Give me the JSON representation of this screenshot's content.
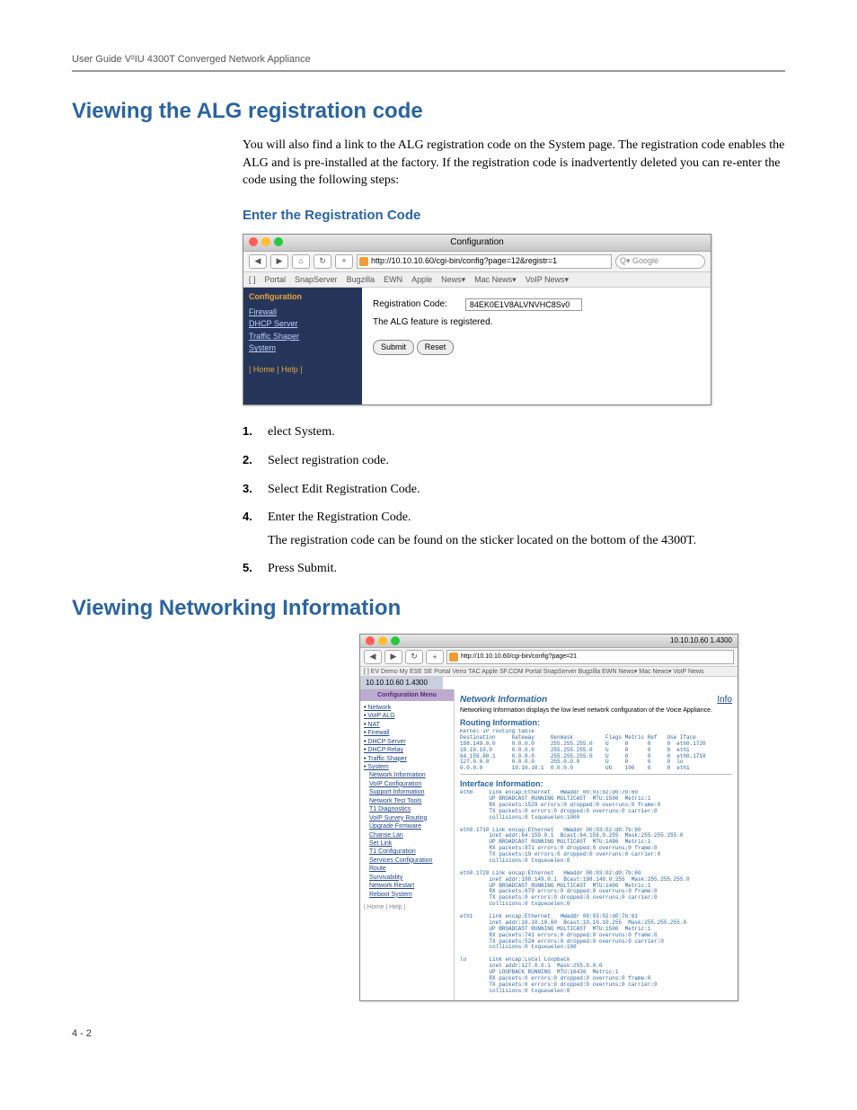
{
  "header": "User Guide V²IU 4300T Converged Network Appliance",
  "section1": {
    "title": "Viewing the ALG registration code",
    "intro": "You will also find a link to the ALG registration code on the System page.  The registration code enables the ALG and is pre-installed at the factory.  If the registration code is inadvertently deleted you can re-enter the code using the following steps:",
    "subhead": "Enter the Registration Code",
    "steps": [
      "elect System.",
      "Select registration code.",
      "Select Edit Registration Code.",
      "Enter the Registration Code.",
      "Press Submit."
    ],
    "step4_sub": "The registration code can be found on the sticker located on the bottom of the 4300T."
  },
  "mock1": {
    "window_title": "Configuration",
    "url": "http://10.10.10.60/cgi-bin/config?page=12&registr=1",
    "search_placeholder": "Q▾ Google",
    "bookmarks": [
      "[ ]",
      "Portal",
      "SnapServer",
      "Bugzilla",
      "EWN",
      "Apple",
      "News▾",
      "Mac News▾",
      "VoIP News▾"
    ],
    "sidebar_title": "Configuration",
    "sidebar_items": [
      "Firewall",
      "DHCP Server",
      "Traffic Shaper",
      "System"
    ],
    "sidebar_footer": "| Home | Help |",
    "reg_label": "Registration Code:",
    "reg_value": "84EK0E1V8ALVNVHC8Sv0",
    "reg_status": "The ALG feature is registered.",
    "btn_submit": "Submit",
    "btn_reset": "Reset"
  },
  "section2": {
    "title": "Viewing Networking Information"
  },
  "mock2": {
    "window_right": "10.10.10.60 1.4300",
    "url": "http://10.10.10.60/cgi-bin/config?page=21",
    "bookmarks": "[ ]   EV Demo   My ESE   SE Portal   Verio TAC   Apple   SF.COM   Portal   SnapServer   Bugzilla   EWN   News▾   Mac News▾   VoIP News",
    "tab": "10.10.10.60 1.4300",
    "side_header": "Configuration Menu",
    "side_links": [
      "Network",
      "VoIP ALG",
      "NAT",
      "Firewall",
      "DHCP Server",
      "DHCP Relay",
      "Traffic Shaper",
      "System"
    ],
    "side_sublinks": [
      "Network Information",
      "VoIP Configuration",
      "Support Information",
      "Network Test Tools",
      "T1 Diagnostics",
      "VoIP Survey Routing",
      "Upgrade Firmware",
      "Chanse Lan",
      "Set Link",
      "T1 Configuration",
      "Services Configuration",
      "Route",
      "Survivability",
      "Network Restart",
      "Reboot System"
    ],
    "side_footer": "| Home | Help |",
    "main_title": "Network Information",
    "info_link": "Info",
    "main_desc": "Networking Information displays the low level network configuration of the Voice Appliance.",
    "routing_title": "Routing Information:",
    "routing_block": "Kernel IP routing table\nDestination     Gateway     Genmask          Flags Metric Ref   Use Iface\n198.149.0.0     0.0.0.0     255.255.255.0    U     0      0     0  eth0.1720\n10.10.10.0      0.0.0.0     255.255.255.0    U     0      0     0  eth1\n64.159.90.1     0.0.0.0     255.255.255.0    U     0      0     0  eth0.1710\n127.0.0.0       0.0.0.0     255.0.0.0        U     0      0     0  lo\n0.0.0.0         10.10.10.1  0.0.0.0          UG    100    0     0  eth1",
    "interface_title": "Interface Information:",
    "interface_block": "eth0     Link encap:Ethernet   HWaddr 00:03:02:d0:7b:60\n         UP BROADCAST RUNNING MULTICAST  MTU:1500  Metric:1\n         RX packets:1529 errors:0 dropped:0 overruns:0 frame:0\n         TX packets:0 errors:0 dropped:0 overruns:0 carrier:0\n         collisions:0 txqueuelen:1000\n\neth0.1710 Link encap:Ethernet   HWaddr 00:03:02:d0:7b:60\n         inet addr:64.159.0.1  Bcast:64.159.0.255  Mask:255.255.255.0\n         UP BROADCAST RUNNING MULTICAST  MTU:1496  Metric:1\n         RX packets:871 errors:0 dropped:0 overruns:0 frame:0\n         TX packets:19 errors:0 dropped:0 overruns:0 carrier:0\n         collisions:0 txqueuelen:0\n\neth0.1720 Link encap:Ethernet   HWaddr 00:03:02:d0:7b:60\n         inet addr:198.149.0.1  Bcast:198.149.0.255  Mask:255.255.255.0\n         UP BROADCAST RUNNING MULTICAST  MTU:1496  Metric:1\n         RX packets:679 errors:0 dropped:0 overruns:0 frame:0\n         TX packets:0 errors:0 dropped:0 overruns:0 carrier:0\n         collisions:0 txqueuelen:0\n\neth1     Link encap:Ethernet   HWaddr 00:03:02:d0:7b:61\n         inet addr:10.10.10.60  Bcast:10.10.10.255  Mask:255.255.255.0\n         UP BROADCAST RUNNING MULTICAST  MTU:1500  Metric:1\n         RX packets:741 errors:0 dropped:0 overruns:0 frame:0\n         TX packets:524 errors:0 dropped:0 overruns:0 carrier:0\n         collisions:0 txqueuelen:100\n\nlo       Link encap:Local Loopback\n         inet addr:127.0.0.1  Mask:255.0.0.0\n         UP LOOPBACK RUNNING  MTU:16436  Metric:1\n         RX packets:0 errors:0 dropped:0 overruns:0 frame:0\n         TX packets:0 errors:0 dropped:0 overruns:0 carrier:0\n         collisions:0 txqueuelen:0"
  },
  "footer": "4 - 2"
}
